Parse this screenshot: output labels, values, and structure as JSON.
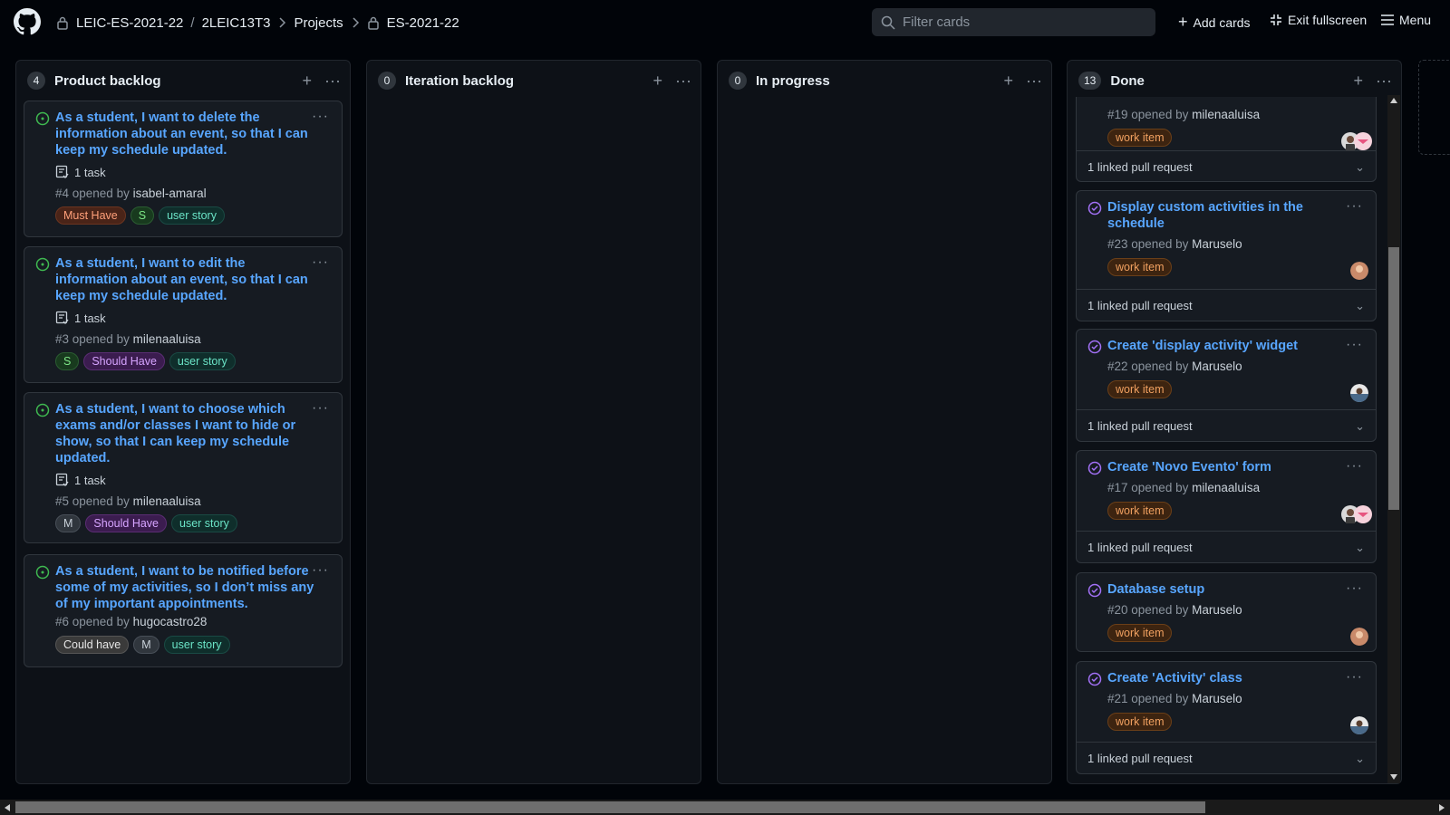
{
  "header": {
    "org": "LEIC-ES-2021-22",
    "repo": "2LEIC13T3",
    "projects": "Projects",
    "project": "ES-2021-22",
    "search_placeholder": "Filter cards",
    "add_cards": "Add cards",
    "exit_fullscreen": "Exit fullscreen",
    "menu": "Menu"
  },
  "columns": [
    {
      "count": "4",
      "title": "Product backlog",
      "cards": [
        {
          "title_lines": [
            "As a student, I want to delete the",
            "information about an event, so that I can",
            "keep my schedule updated."
          ],
          "task": "1 task",
          "number": "#4 opened by",
          "author": "isabel-amaral",
          "labels": [
            "Must Have",
            "S",
            "user story"
          ]
        },
        {
          "title_lines": [
            "As a student, I want to edit the",
            "information about an event, so that I can",
            "keep my schedule updated."
          ],
          "task": "1 task",
          "number": "#3 opened by",
          "author": "milenaaluisa",
          "labels": [
            "S",
            "Should Have",
            "user story"
          ]
        },
        {
          "title_lines": [
            "As a student, I want to choose which",
            "exams and/or classes I want to hide or",
            "show, so that I can keep my schedule",
            "updated."
          ],
          "task": "1 task",
          "number": "#5 opened by",
          "author": "milenaaluisa",
          "labels": [
            "M",
            "Should Have",
            "user story"
          ]
        },
        {
          "title_lines": [
            "As a student, I want to be notified before",
            "some of my activities, so I don’t miss any",
            "of my important appointments."
          ],
          "number": "#6 opened by",
          "author": "hugocastro28",
          "labels": [
            "Could have",
            "M",
            "user story"
          ]
        }
      ]
    },
    {
      "count": "0",
      "title": "Iteration backlog",
      "cards": []
    },
    {
      "count": "0",
      "title": "In progress",
      "cards": []
    },
    {
      "count": "13",
      "title": "Done",
      "cards": [
        {
          "number": "#19 opened by",
          "author": "milenaaluisa",
          "label": "work item",
          "linked": "1 linked pull request"
        },
        {
          "title_lines": [
            "Display custom activities in the",
            "schedule"
          ],
          "number": "#23 opened by",
          "author": "Maruselo",
          "label": "work item",
          "linked": "1 linked pull request"
        },
        {
          "title_lines": [
            "Create 'display activity' widget"
          ],
          "number": "#22 opened by",
          "author": "Maruselo",
          "label": "work item",
          "linked": "1 linked pull request"
        },
        {
          "title_lines": [
            "Create 'Novo Evento' form"
          ],
          "number": "#17 opened by",
          "author": "milenaaluisa",
          "label": "work item",
          "linked": "1 linked pull request"
        },
        {
          "title_lines": [
            "Database setup"
          ],
          "number": "#20 opened by",
          "author": "Maruselo",
          "label": "work item"
        },
        {
          "title_lines": [
            "Create 'Activity' class"
          ],
          "number": "#21 opened by",
          "author": "Maruselo",
          "label": "work item",
          "linked": "1 linked pull request"
        }
      ]
    }
  ],
  "colors": {
    "background": "#010409",
    "column": "#0d1117",
    "card": "#161b22",
    "link": "#58a6ff",
    "open_icon": "#3fb950",
    "closed_icon": "#a371f7"
  }
}
